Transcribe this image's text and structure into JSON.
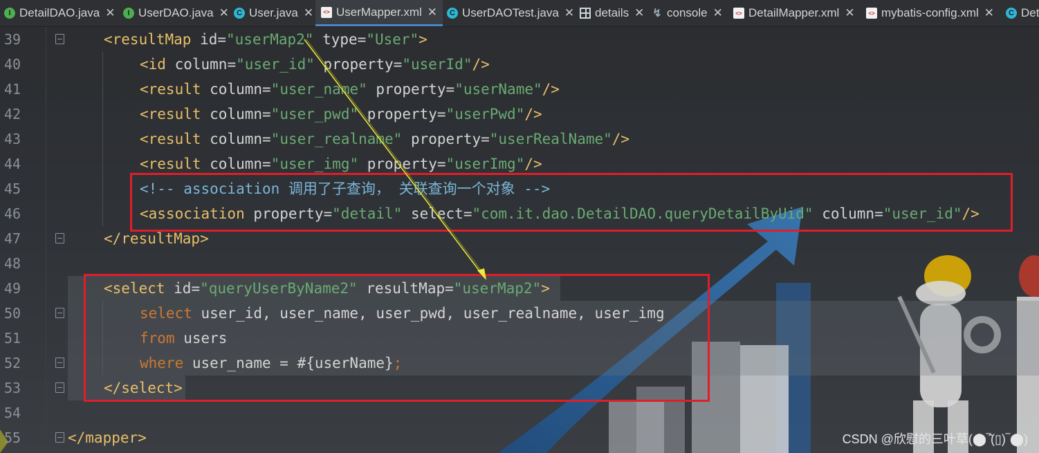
{
  "tabs": [
    {
      "label": "DetailDAO.java",
      "icon": "interface-icon",
      "active": false
    },
    {
      "label": "UserDAO.java",
      "icon": "interface-icon",
      "active": false
    },
    {
      "label": "User.java",
      "icon": "class-icon",
      "active": false
    },
    {
      "label": "UserMapper.xml",
      "icon": "xml-file-icon",
      "active": true
    },
    {
      "label": "UserDAOTest.java",
      "icon": "test-class-icon",
      "active": false
    },
    {
      "label": "details",
      "icon": "table-icon",
      "active": false
    },
    {
      "label": "console",
      "icon": "console-icon",
      "active": false
    },
    {
      "label": "DetailMapper.xml",
      "icon": "xml-file-icon",
      "active": false
    },
    {
      "label": "mybatis-config.xml",
      "icon": "xml-file-icon",
      "active": false
    },
    {
      "label": "Det",
      "icon": "class-icon",
      "active": false
    }
  ],
  "lines": {
    "n39": "39",
    "n40": "40",
    "n41": "41",
    "n42": "42",
    "n43": "43",
    "n44": "44",
    "n45": "45",
    "n46": "46",
    "n47": "47",
    "n48": "48",
    "n49": "49",
    "n50": "50",
    "n51": "51",
    "n52": "52",
    "n53": "53",
    "n54": "54",
    "n55": "55"
  },
  "code": {
    "l39": {
      "open": "<resultMap",
      "a1": " id=",
      "v1": "\"userMap2\"",
      "a2": " type=",
      "v2": "\"User\"",
      "close": ">"
    },
    "l40": {
      "open": "<id",
      "a1": " column=",
      "v1": "\"user_id\"",
      "a2": " property=",
      "v2": "\"userId\"",
      "close": "/>"
    },
    "l41": {
      "open": "<result",
      "a1": " column=",
      "v1": "\"user_name\"",
      "a2": " property=",
      "v2": "\"userName\"",
      "close": "/>"
    },
    "l42": {
      "open": "<result",
      "a1": " column=",
      "v1": "\"user_pwd\"",
      "a2": " property=",
      "v2": "\"userPwd\"",
      "close": "/>"
    },
    "l43": {
      "open": "<result",
      "a1": " column=",
      "v1": "\"user_realname\"",
      "a2": " property=",
      "v2": "\"userRealName\"",
      "close": "/>"
    },
    "l44": {
      "open": "<result",
      "a1": " column=",
      "v1": "\"user_img\"",
      "a2": " property=",
      "v2": "\"userImg\"",
      "close": "/>"
    },
    "l45": {
      "comment": "<!-- association 调用了子查询， 关联查询一个对象 -->"
    },
    "l46": {
      "open": "<association",
      "a1": " property=",
      "v1": "\"detail\"",
      "a2": " select=",
      "v2": "\"com.it.dao.DetailDAO.queryDetailByUid\"",
      "a3": " column=",
      "v3": "\"user_id\"",
      "close": "/>"
    },
    "l47": {
      "text": "</resultMap>"
    },
    "l49": {
      "open": "<select",
      "a1": " id=",
      "v1": "\"queryUserByName2\"",
      "a2": " resultMap=",
      "v2": "\"userMap2\"",
      "close": ">"
    },
    "l50": {
      "kw": "select",
      "cols": " user_id, user_name, user_pwd, user_realname, user_img"
    },
    "l51": {
      "kw": "from",
      "rest": " users"
    },
    "l52": {
      "kw": "where",
      "rest": " user_name = #{userName}",
      "semi": ";"
    },
    "l53": {
      "text": "</select>"
    },
    "l55": {
      "text": "</mapper>"
    }
  },
  "watermark": "CSDN @欣慰的三叶草(⬤‾̑̑(▯)‾⬤)",
  "colors": {
    "annotation_box": "#e01e2a",
    "tag": "#e8bf6a",
    "string": "#6aab73",
    "keyword": "#cc7832",
    "comment": "#7ab6d8"
  }
}
